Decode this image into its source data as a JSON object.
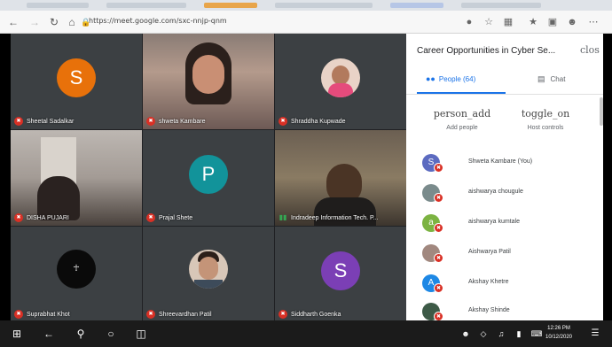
{
  "browser": {
    "url": "https://meet.google.com/sxc-nnjp-qnm"
  },
  "tiles": [
    {
      "name": "Sheetal Sadalkar",
      "initial": "S",
      "avatar_color": "#e8710a",
      "mic": "muted"
    },
    {
      "name": "shweta Kambare",
      "initial": "",
      "avatar_color": "",
      "mic": "muted"
    },
    {
      "name": "Shraddha Kupwade",
      "initial": "",
      "avatar_color": "",
      "mic": "muted"
    },
    {
      "name": "DISHA PUJARI",
      "initial": "",
      "avatar_color": "",
      "mic": "muted"
    },
    {
      "name": "Prajal Shete",
      "initial": "P",
      "avatar_color": "#12939a",
      "mic": "muted"
    },
    {
      "name": "Indradeep Information Tech. P...",
      "initial": "",
      "avatar_color": "",
      "mic": "on"
    },
    {
      "name": "Suprabhat Khot",
      "initial": "",
      "avatar_color": "",
      "mic": "muted"
    },
    {
      "name": "Shreevardhan Patil",
      "initial": "",
      "avatar_color": "",
      "mic": "muted"
    },
    {
      "name": "Siddharth Goenka",
      "initial": "S",
      "avatar_color": "#7b3fb5",
      "mic": "muted"
    }
  ],
  "panel": {
    "title": "Career Opportunities in Cyber Se...",
    "close_label": "clos",
    "tabs": {
      "people": "People (64)",
      "chat": "Chat"
    },
    "actions": [
      {
        "icon_text": "person_add",
        "label": "Add people"
      },
      {
        "icon_text": "toggle_on",
        "label": "Host controls"
      }
    ],
    "people": [
      {
        "name": "Shweta Kambare (You)",
        "initial": "S",
        "color": "#5c6bc0"
      },
      {
        "name": "aishwarya chougule",
        "initial": "",
        "color": "#7a8b8c"
      },
      {
        "name": "aishwarya kumtale",
        "initial": "a",
        "color": "#7cb342"
      },
      {
        "name": "Aishwarya Patil",
        "initial": "",
        "color": "#a1887f"
      },
      {
        "name": "Akshay Khetre",
        "initial": "A",
        "color": "#1e88e5"
      },
      {
        "name": "Akshay Shinde",
        "initial": "",
        "color": "#3d5a47"
      }
    ]
  },
  "taskbar": {
    "time": "12:26 PM",
    "date": "10/12/2020"
  },
  "colors": {
    "accent": "#1a73e8",
    "muted_red": "#d93025",
    "tile_bg": "#3c4043"
  }
}
